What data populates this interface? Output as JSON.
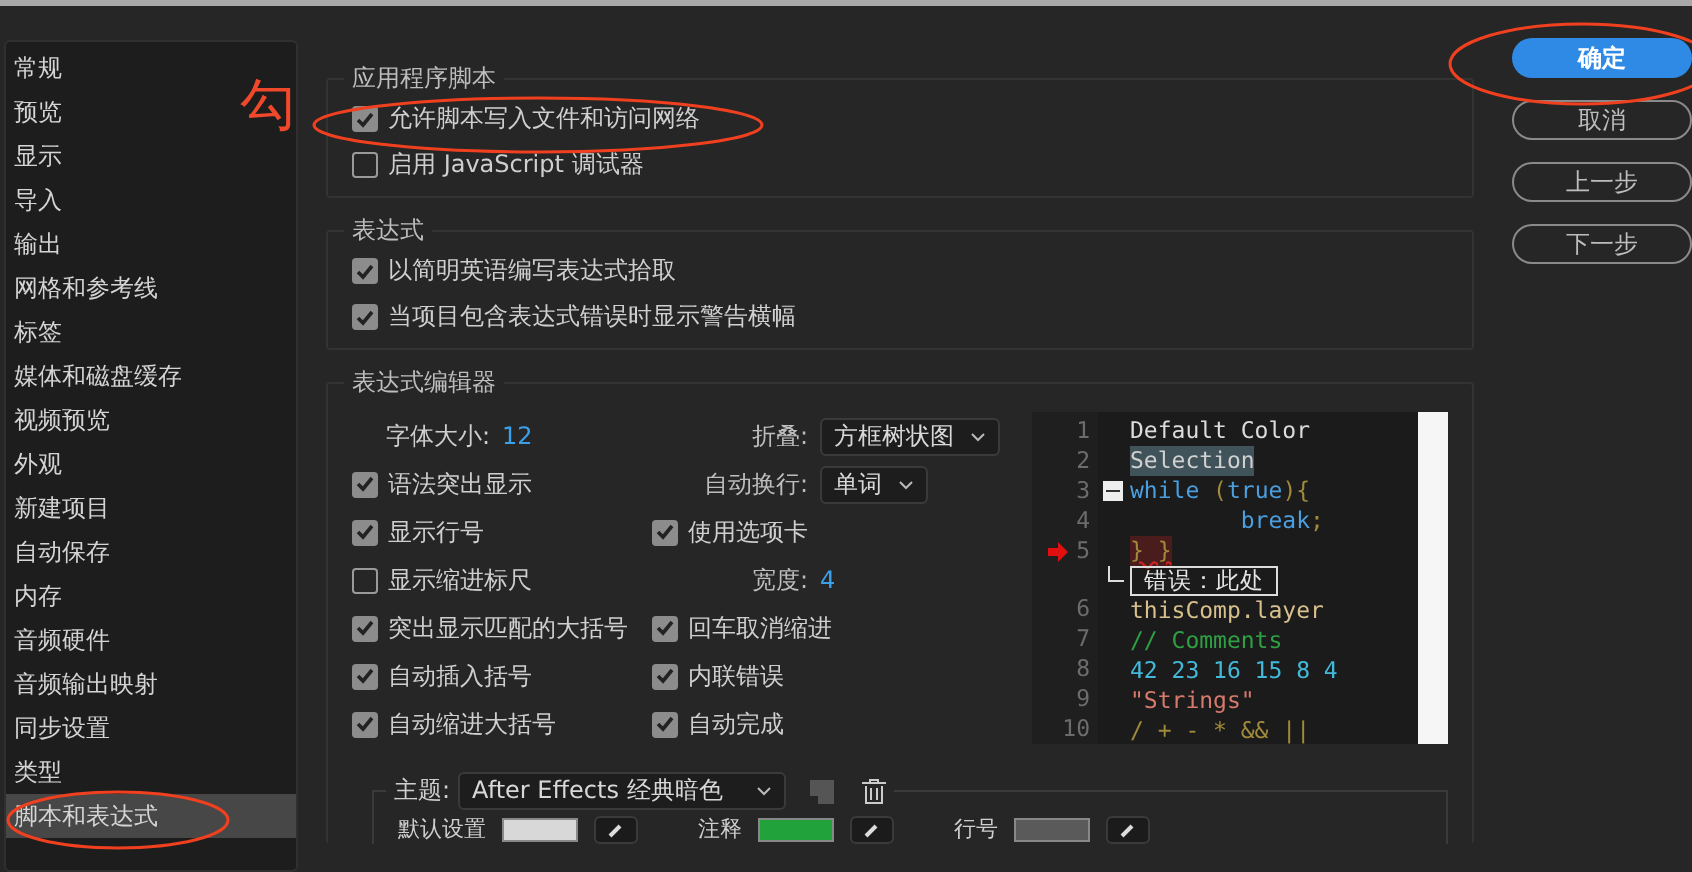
{
  "sidebar": {
    "items": [
      {
        "label": "常规",
        "selected": false
      },
      {
        "label": "预览",
        "selected": false
      },
      {
        "label": "显示",
        "selected": false
      },
      {
        "label": "导入",
        "selected": false
      },
      {
        "label": "输出",
        "selected": false
      },
      {
        "label": "网格和参考线",
        "selected": false
      },
      {
        "label": "标签",
        "selected": false
      },
      {
        "label": "媒体和磁盘缓存",
        "selected": false
      },
      {
        "label": "视频预览",
        "selected": false
      },
      {
        "label": "外观",
        "selected": false
      },
      {
        "label": "新建项目",
        "selected": false
      },
      {
        "label": "自动保存",
        "selected": false
      },
      {
        "label": "内存",
        "selected": false
      },
      {
        "label": "音频硬件",
        "selected": false
      },
      {
        "label": "音频输出映射",
        "selected": false
      },
      {
        "label": "同步设置",
        "selected": false
      },
      {
        "label": "类型",
        "selected": false
      },
      {
        "label": "脚本和表达式",
        "selected": true
      }
    ]
  },
  "annotation": {
    "mark": "勾"
  },
  "sections": [
    {
      "title": "应用程序脚本",
      "checkboxes": [
        {
          "label": "允许脚本写入文件和访问网络",
          "checked": true
        },
        {
          "label": "启用 JavaScript 调试器",
          "checked": false
        }
      ]
    },
    {
      "title": "表达式",
      "checkboxes": [
        {
          "label": "以简明英语编写表达式拾取",
          "checked": true
        },
        {
          "label": "当项目包含表达式错误时显示警告横幅",
          "checked": true
        }
      ]
    }
  ],
  "editor": {
    "title": "表达式编辑器",
    "font_size": {
      "label": "字体大小:",
      "value": "12"
    },
    "fold": {
      "label": "折叠:",
      "value": "方框树状图"
    },
    "wrap": {
      "label": "自动换行:",
      "value": "单词"
    },
    "tabs": {
      "label": "使用选项卡",
      "checked": true
    },
    "width": {
      "label": "宽度:",
      "value": "4"
    },
    "left_options": [
      {
        "label": "语法突出显示",
        "checked": true
      },
      {
        "label": "显示行号",
        "checked": true
      },
      {
        "label": "显示缩进标尺",
        "checked": false
      },
      {
        "label": "突出显示匹配的大括号",
        "checked": true
      },
      {
        "label": "自动插入括号",
        "checked": true
      },
      {
        "label": "自动缩进大括号",
        "checked": true
      }
    ],
    "right_options": [
      {
        "label": "回车取消缩进",
        "checked": true
      },
      {
        "label": "内联错误",
        "checked": true
      },
      {
        "label": "自动完成",
        "checked": true
      }
    ],
    "preview": {
      "lines": [
        {
          "kind": "code",
          "number": "1",
          "tokens": [
            {
              "kind": "default",
              "text": "Default Color"
            }
          ]
        },
        {
          "kind": "code",
          "number": "2",
          "tokens": [
            {
              "kind": "selection",
              "text": "Selection"
            }
          ]
        },
        {
          "kind": "fold",
          "number": "3",
          "tokens": [
            {
              "kind": "keyword",
              "text": "while"
            },
            {
              "kind": "operator",
              "text": " ("
            },
            {
              "kind": "keyword",
              "text": "true"
            },
            {
              "kind": "operator",
              "text": "){"
            }
          ]
        },
        {
          "kind": "code",
          "number": "4",
          "tokens": [
            {
              "kind": "keyword",
              "text": "        break"
            },
            {
              "kind": "operator",
              "text": ";"
            }
          ]
        },
        {
          "kind": "error",
          "number": "5",
          "tokens": [
            {
              "kind": "error",
              "text": "} }"
            }
          ]
        },
        {
          "kind": "tip",
          "tokens": [
            {
              "kind": "tip",
              "text": "错误：此处"
            }
          ]
        },
        {
          "kind": "code",
          "number": "6",
          "tokens": [
            {
              "kind": "property",
              "text": "thisComp.layer"
            }
          ]
        },
        {
          "kind": "code",
          "number": "7",
          "tokens": [
            {
              "kind": "comment",
              "text": "// Comments"
            }
          ]
        },
        {
          "kind": "code",
          "number": "8",
          "tokens": [
            {
              "kind": "number",
              "text": "42 23 16 15 8 4"
            }
          ]
        },
        {
          "kind": "code",
          "number": "9",
          "tokens": [
            {
              "kind": "string",
              "text": "\"Strings\""
            }
          ]
        },
        {
          "kind": "code",
          "number": "10",
          "tokens": [
            {
              "kind": "operator",
              "text": "/ + - * && ||"
            }
          ]
        }
      ]
    },
    "theme": {
      "label": "主题:",
      "value": "After Effects 经典暗色",
      "swatches": [
        {
          "label": "默认设置",
          "color": "#d8d8d8"
        },
        {
          "label": "注释",
          "color": "#22a23a"
        },
        {
          "label": "行号",
          "color": "#5a5a5a"
        }
      ]
    }
  },
  "buttons": [
    {
      "label": "确定",
      "primary": true
    },
    {
      "label": "取消",
      "primary": false
    },
    {
      "label": "上一步",
      "primary": false
    },
    {
      "label": "下一步",
      "primary": false
    }
  ]
}
